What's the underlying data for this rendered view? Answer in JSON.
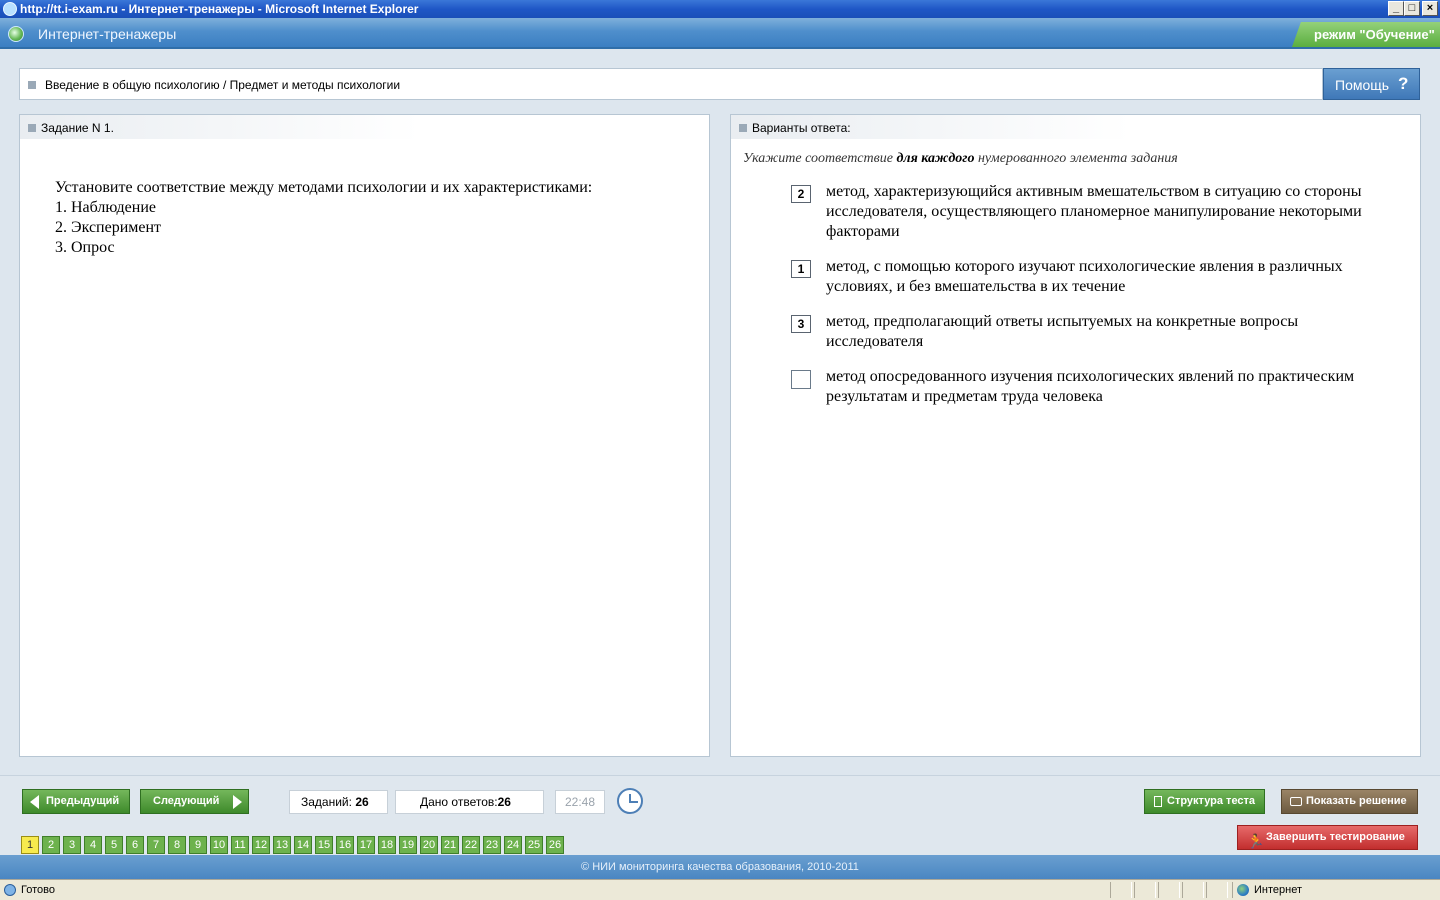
{
  "window": {
    "title": "http://tt.i-exam.ru - Интернет-тренажеры - Microsoft Internet Explorer"
  },
  "app": {
    "title": "Интернет-тренажеры",
    "mode": "режим \"Обучение\""
  },
  "breadcrumb": "Введение в общую психологию / Предмет и методы психологии",
  "help_label": "Помощь",
  "task": {
    "header": "Задание N 1.",
    "lines": [
      "Установите соответствие между методами психологии и их характеристиками:",
      "1. Наблюдение",
      "2. Эксперимент",
      "3. Опрос"
    ]
  },
  "answers": {
    "header": "Варианты ответа:",
    "instruction_pre": "Укажите соответствие ",
    "instruction_bold": "для каждого",
    "instruction_post": " нумерованного элемента задания",
    "options": [
      {
        "num": "2",
        "text": "метод, характеризующийся активным вмешательством в ситуацию со стороны исследователя, осуществляющего планомерное манипулирование некоторыми факторами"
      },
      {
        "num": "1",
        "text": "метод, с помощью которого изучают психологические явления в различных условиях, и без вмешательства в их течение"
      },
      {
        "num": "3",
        "text": "метод, предполагающий ответы испытуемых на конкретные вопросы исследователя"
      },
      {
        "num": "",
        "text": "метод опосредованного изучения психологических явлений по практическим результатам и предметам труда человека"
      }
    ]
  },
  "toolbar": {
    "prev_label": "Предыдущий",
    "next_label": "Следующий",
    "tasks_label": "Заданий:",
    "tasks_value": "26",
    "answers_label": "Дано ответов:",
    "answers_value": "26",
    "timer": "22:48",
    "structure_label": "Структура теста",
    "solution_label": "Показать решение",
    "finish_label": "Завершить тестирование"
  },
  "task_numbers": [
    "1",
    "2",
    "3",
    "4",
    "5",
    "6",
    "7",
    "8",
    "9",
    "10",
    "11",
    "12",
    "13",
    "14",
    "15",
    "16",
    "17",
    "18",
    "19",
    "20",
    "21",
    "22",
    "23",
    "24",
    "25",
    "26"
  ],
  "active_task": "1",
  "footer": "© НИИ мониторинга качества образования, 2010-2011",
  "status": {
    "text": "Готово",
    "zone": "Интернет"
  },
  "colors": {
    "accent_blue": "#4f8fcc",
    "button_green": "#4f9a3a",
    "active_yellow": "#f7ea4e",
    "finish_red": "#d24444"
  }
}
